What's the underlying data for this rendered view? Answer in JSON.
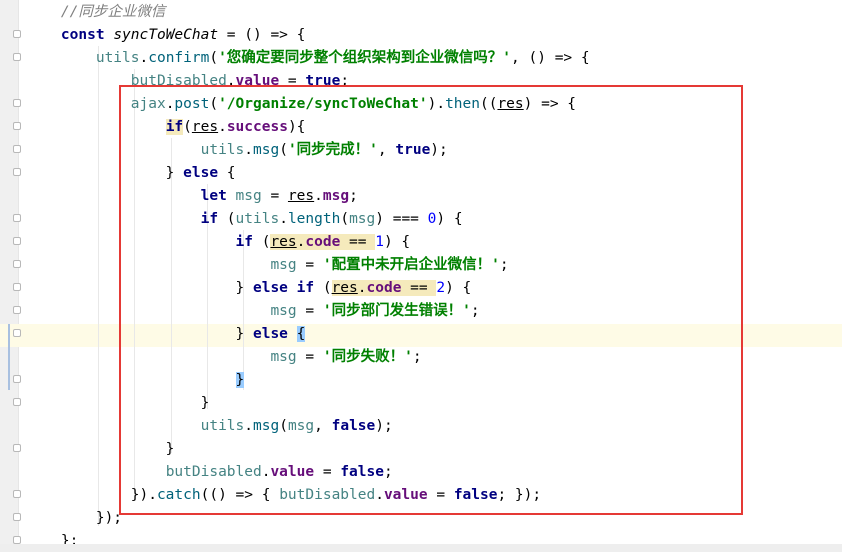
{
  "editor": {
    "lines": [
      [
        {
          "t": "    //同步企业微信",
          "c": "cmt"
        }
      ],
      [
        {
          "t": "    "
        },
        {
          "t": "const",
          "c": "kw"
        },
        {
          "t": " "
        },
        {
          "t": "syncToWeChat",
          "c": "it"
        },
        {
          "t": " = () => {"
        }
      ],
      [
        {
          "t": "        "
        },
        {
          "t": "utils",
          "c": "var"
        },
        {
          "t": "."
        },
        {
          "t": "confirm",
          "c": "fn"
        },
        {
          "t": "("
        },
        {
          "t": "'您确定要同步整个组织架构到企业微信吗？'",
          "c": "str"
        },
        {
          "t": ", () => {"
        }
      ],
      [
        {
          "t": "            "
        },
        {
          "t": "butDisabled",
          "c": "var"
        },
        {
          "t": "."
        },
        {
          "t": "value",
          "c": "prop"
        },
        {
          "t": " = "
        },
        {
          "t": "true",
          "c": "kw"
        },
        {
          "t": ";"
        }
      ],
      [
        {
          "t": "            "
        },
        {
          "t": "ajax",
          "c": "var"
        },
        {
          "t": "."
        },
        {
          "t": "post",
          "c": "fn"
        },
        {
          "t": "("
        },
        {
          "t": "'/Organize/syncToWeChat'",
          "c": "str"
        },
        {
          "t": ")."
        },
        {
          "t": "then",
          "c": "fn"
        },
        {
          "t": "(("
        },
        {
          "t": "res",
          "c": "ul"
        },
        {
          "t": ") => {"
        }
      ],
      [
        {
          "t": "                "
        },
        {
          "t": "if",
          "c": "kw hl"
        },
        {
          "t": "("
        },
        {
          "t": "res",
          "c": "ul"
        },
        {
          "t": "."
        },
        {
          "t": "success",
          "c": "prop"
        },
        {
          "t": "){"
        }
      ],
      [
        {
          "t": "                    "
        },
        {
          "t": "utils",
          "c": "var"
        },
        {
          "t": "."
        },
        {
          "t": "msg",
          "c": "fn"
        },
        {
          "t": "("
        },
        {
          "t": "'同步完成！'",
          "c": "str"
        },
        {
          "t": ", "
        },
        {
          "t": "true",
          "c": "kw"
        },
        {
          "t": ");"
        }
      ],
      [
        {
          "t": "                } "
        },
        {
          "t": "else",
          "c": "kw"
        },
        {
          "t": " {"
        }
      ],
      [
        {
          "t": "                    "
        },
        {
          "t": "let",
          "c": "kw"
        },
        {
          "t": " "
        },
        {
          "t": "msg",
          "c": "var"
        },
        {
          "t": " = "
        },
        {
          "t": "res",
          "c": "ul"
        },
        {
          "t": "."
        },
        {
          "t": "msg",
          "c": "prop"
        },
        {
          "t": ";"
        }
      ],
      [
        {
          "t": "                    "
        },
        {
          "t": "if",
          "c": "kw"
        },
        {
          "t": " ("
        },
        {
          "t": "utils",
          "c": "var"
        },
        {
          "t": "."
        },
        {
          "t": "length",
          "c": "fn"
        },
        {
          "t": "("
        },
        {
          "t": "msg",
          "c": "var"
        },
        {
          "t": ") === "
        },
        {
          "t": "0",
          "c": "num"
        },
        {
          "t": ") {"
        }
      ],
      [
        {
          "t": "                        "
        },
        {
          "t": "if",
          "c": "kw"
        },
        {
          "t": " ("
        },
        {
          "t": "res",
          "c": "ul hl"
        },
        {
          "t": ".",
          "c": "hl"
        },
        {
          "t": "code",
          "c": "prop hl"
        },
        {
          "t": " == ",
          "c": "hl"
        },
        {
          "t": "1",
          "c": "num"
        },
        {
          "t": ") {"
        }
      ],
      [
        {
          "t": "                            "
        },
        {
          "t": "msg",
          "c": "var"
        },
        {
          "t": " = "
        },
        {
          "t": "'配置中未开启企业微信！'",
          "c": "str"
        },
        {
          "t": ";"
        }
      ],
      [
        {
          "t": "                        } "
        },
        {
          "t": "else if",
          "c": "kw"
        },
        {
          "t": " ("
        },
        {
          "t": "res",
          "c": "ul hl"
        },
        {
          "t": ".",
          "c": "hl"
        },
        {
          "t": "code",
          "c": "prop hl"
        },
        {
          "t": " == ",
          "c": "hl"
        },
        {
          "t": "2",
          "c": "num"
        },
        {
          "t": ") {"
        }
      ],
      [
        {
          "t": "                            "
        },
        {
          "t": "msg",
          "c": "var"
        },
        {
          "t": " = "
        },
        {
          "t": "'同步部门发生错误！'",
          "c": "str"
        },
        {
          "t": ";"
        }
      ],
      [
        {
          "t": "                        } "
        },
        {
          "t": "else",
          "c": "kw"
        },
        {
          "t": " "
        },
        {
          "t": "{",
          "c": "brace-hl"
        }
      ],
      [
        {
          "t": "                            "
        },
        {
          "t": "msg",
          "c": "var"
        },
        {
          "t": " = "
        },
        {
          "t": "'同步失败！'",
          "c": "str"
        },
        {
          "t": ";"
        }
      ],
      [
        {
          "t": "                        "
        },
        {
          "t": "}",
          "c": "brace-hl"
        }
      ],
      [
        {
          "t": "                    }"
        }
      ],
      [
        {
          "t": "                    "
        },
        {
          "t": "utils",
          "c": "var"
        },
        {
          "t": "."
        },
        {
          "t": "msg",
          "c": "fn"
        },
        {
          "t": "("
        },
        {
          "t": "msg",
          "c": "var"
        },
        {
          "t": ", "
        },
        {
          "t": "false",
          "c": "kw"
        },
        {
          "t": ");"
        }
      ],
      [
        {
          "t": "                }"
        }
      ],
      [
        {
          "t": "                "
        },
        {
          "t": "butDisabled",
          "c": "var"
        },
        {
          "t": "."
        },
        {
          "t": "value",
          "c": "prop"
        },
        {
          "t": " = "
        },
        {
          "t": "false",
          "c": "kw"
        },
        {
          "t": ";"
        }
      ],
      [
        {
          "t": "            })."
        },
        {
          "t": "catch",
          "c": "fn"
        },
        {
          "t": "(() => { "
        },
        {
          "t": "butDisabled",
          "c": "var"
        },
        {
          "t": "."
        },
        {
          "t": "value",
          "c": "prop"
        },
        {
          "t": " = "
        },
        {
          "t": "false",
          "c": "kw"
        },
        {
          "t": "; });"
        }
      ],
      [
        {
          "t": "        });"
        }
      ],
      [
        {
          "t": "    };"
        }
      ]
    ]
  },
  "colors": {
    "keyword": "#000080",
    "string": "#008000",
    "property": "#660e7a",
    "comment": "#808080",
    "annotation_box": "#e53935"
  }
}
